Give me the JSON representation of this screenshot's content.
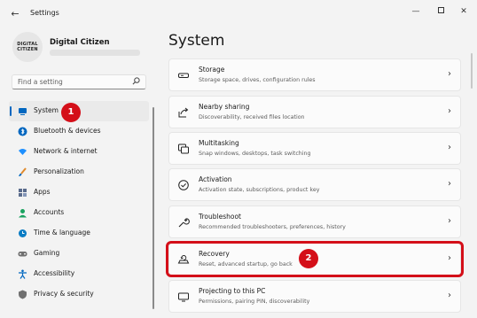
{
  "window": {
    "title": "Settings",
    "back": "←",
    "minimize": "—",
    "close": "✕"
  },
  "profile": {
    "avatar_text": "DIGITAL CITIZEN",
    "name": "Digital Citizen"
  },
  "search": {
    "placeholder": "Find a setting",
    "icon": "search-icon"
  },
  "nav": {
    "items": [
      {
        "label": "System",
        "icon": "system-display-icon",
        "color": "#0067c0",
        "active": true
      },
      {
        "label": "Bluetooth & devices",
        "icon": "bluetooth-icon",
        "color": "#0067c0"
      },
      {
        "label": "Network & internet",
        "icon": "wifi-icon",
        "color": "#1e90ff"
      },
      {
        "label": "Personalization",
        "icon": "brush-icon",
        "color": "#e08a2c"
      },
      {
        "label": "Apps",
        "icon": "apps-icon",
        "color": "#5a6b8c"
      },
      {
        "label": "Accounts",
        "icon": "person-icon",
        "color": "#1aa260"
      },
      {
        "label": "Time & language",
        "icon": "globe-clock-icon",
        "color": "#0a7cc4"
      },
      {
        "label": "Gaming",
        "icon": "gamepad-icon",
        "color": "#707070"
      },
      {
        "label": "Accessibility",
        "icon": "accessibility-icon",
        "color": "#0067c0"
      },
      {
        "label": "Privacy & security",
        "icon": "shield-icon",
        "color": "#707070"
      }
    ]
  },
  "main": {
    "title": "System",
    "cards": [
      {
        "title": "Storage",
        "subtitle": "Storage space, drives, configuration rules",
        "icon": "storage-drive-icon"
      },
      {
        "title": "Nearby sharing",
        "subtitle": "Discoverability, received files location",
        "icon": "share-icon"
      },
      {
        "title": "Multitasking",
        "subtitle": "Snap windows, desktops, task switching",
        "icon": "multitasking-icon"
      },
      {
        "title": "Activation",
        "subtitle": "Activation state, subscriptions, product key",
        "icon": "check-circle-icon"
      },
      {
        "title": "Troubleshoot",
        "subtitle": "Recommended troubleshooters, preferences, history",
        "icon": "wrench-icon"
      },
      {
        "title": "Recovery",
        "subtitle": "Reset, advanced startup, go back",
        "icon": "recovery-icon"
      },
      {
        "title": "Projecting to this PC",
        "subtitle": "Permissions, pairing PIN, discoverability",
        "icon": "projector-icon"
      }
    ]
  },
  "annotations": {
    "badge_1": "1",
    "badge_2": "2",
    "highlight_color": "#d40f19"
  }
}
